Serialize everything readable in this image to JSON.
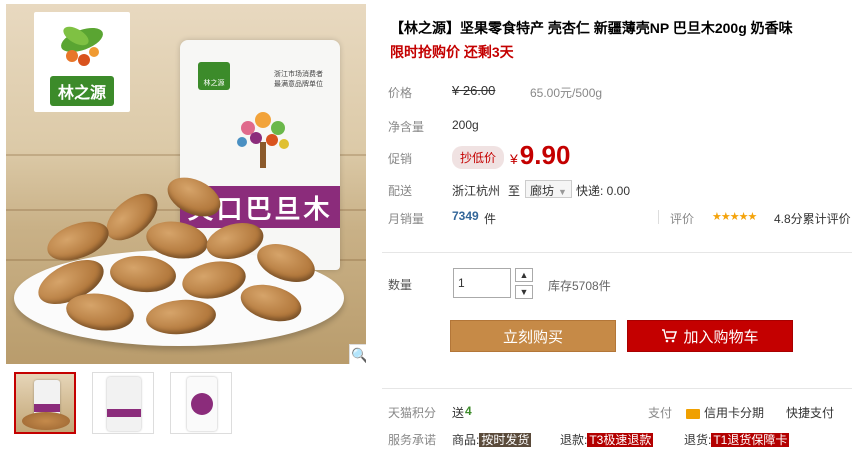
{
  "product": {
    "title": "【林之源】坚果零食特产 壳杏仁 新疆薄壳NP 巴旦木200g 奶香味",
    "subtitle": "限时抢购价 还剩3天"
  },
  "gallery": {
    "logo_text": "林之源",
    "pouch_brand": "林之源",
    "pouch_name": "笑口巴旦木",
    "pouch_award": "浙江市场消费者\n最满意品牌单位",
    "thumbs": [
      "thumb-1",
      "thumb-2",
      "thumb-3"
    ],
    "zoom_icon": "magnifier-icon"
  },
  "price": {
    "label": "价格",
    "original": "¥ 26.00",
    "unit_price": "65.00元/500g"
  },
  "net": {
    "label": "净含量",
    "value": "200g"
  },
  "promo": {
    "label": "促销",
    "badge": "抄低价",
    "currency": "¥",
    "price": "9.90"
  },
  "shipping": {
    "label": "配送",
    "from": "浙江杭州",
    "to_word": "至",
    "destination": "廊坊",
    "express": "快递: 0.00"
  },
  "sales": {
    "label": "月销量",
    "count": "7349",
    "unit": "件",
    "rating_label": "评价",
    "stars": "★★★★★",
    "rating": "4.8分累计评价"
  },
  "quantity": {
    "label": "数量",
    "value": "1",
    "stock": "库存5708件"
  },
  "buttons": {
    "buy": "立刻购买",
    "cart": "加入购物车"
  },
  "points": {
    "label": "天猫积分",
    "prefix": "送",
    "value": "4",
    "pay_label": "支付",
    "credit": "信用卡分期",
    "quick": "快捷支付"
  },
  "service": {
    "label": "服务承诺",
    "goods_label": "商品:",
    "goods_tag": "按时发货",
    "refund_label": "退款:",
    "refund_tag": "T3极速退款",
    "return_label": "退货:",
    "return_tag": "T1退货保障卡"
  },
  "colors": {
    "accent": "#c40000",
    "buy": "#c68a47",
    "brand_green": "#3c8b2a",
    "pouch_purple": "#8b2c7b"
  }
}
